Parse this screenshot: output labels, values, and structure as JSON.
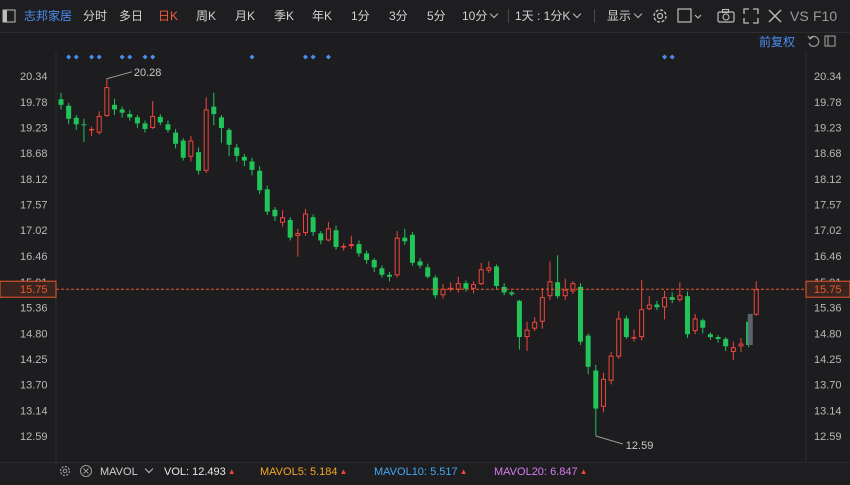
{
  "toolbar": {
    "stock_name": "志邦家居",
    "periods": [
      "分时",
      "多日",
      "日K",
      "周K",
      "月K",
      "季K",
      "年K",
      "1分",
      "3分",
      "5分",
      "10分"
    ],
    "active_period": "日K",
    "multi_period": "1天 : 1分K",
    "display": "显示",
    "vs": "VS",
    "f10": "F10"
  },
  "subbar": {
    "adjust": "前复权"
  },
  "colors": {
    "up": "#f0453c",
    "down": "#22c45a",
    "current": "#e85a2c",
    "accent": "#4c8df0"
  },
  "price_axis": {
    "ticks": [
      "20.34",
      "19.78",
      "19.23",
      "18.68",
      "18.12",
      "17.57",
      "17.02",
      "16.46",
      "15.91",
      "15.36",
      "14.80",
      "14.25",
      "13.70",
      "13.14",
      "12.59"
    ],
    "current_price": "15.75",
    "high_label": "20.28",
    "low_label": "12.59"
  },
  "chart_data": {
    "type": "candlestick",
    "series_note": "daily K-line, forward-adjusted",
    "candles": [
      [
        19.84,
        19.72,
        19.98,
        19.62
      ],
      [
        19.7,
        19.42,
        19.76,
        19.3
      ],
      [
        19.44,
        19.3,
        19.5,
        19.18
      ],
      [
        19.3,
        19.28,
        19.42,
        18.92
      ],
      [
        19.18,
        19.2,
        19.25,
        19.05
      ],
      [
        19.12,
        19.48,
        19.58,
        19.08
      ],
      [
        19.48,
        20.1,
        20.28,
        19.46
      ],
      [
        19.72,
        19.62,
        19.85,
        19.5
      ],
      [
        19.62,
        19.55,
        19.68,
        19.45
      ],
      [
        19.52,
        19.45,
        19.6,
        19.38
      ],
      [
        19.45,
        19.32,
        19.5,
        19.22
      ],
      [
        19.32,
        19.2,
        19.38,
        19.12
      ],
      [
        19.22,
        19.48,
        19.8,
        19.2
      ],
      [
        19.46,
        19.34,
        19.52,
        19.28
      ],
      [
        19.3,
        19.18,
        19.38,
        19.12
      ],
      [
        19.12,
        18.88,
        19.2,
        18.78
      ],
      [
        18.95,
        18.58,
        19.0,
        18.52
      ],
      [
        18.6,
        18.95,
        19.05,
        18.5
      ],
      [
        18.7,
        18.3,
        18.8,
        18.22
      ],
      [
        18.3,
        19.62,
        19.88,
        18.25
      ],
      [
        19.68,
        19.52,
        19.98,
        19.28
      ],
      [
        19.45,
        19.22,
        19.5,
        18.9
      ],
      [
        19.18,
        18.86,
        19.22,
        18.62
      ],
      [
        18.8,
        18.62,
        18.88,
        18.5
      ],
      [
        18.6,
        18.52,
        18.66,
        18.4
      ],
      [
        18.5,
        18.32,
        18.58,
        18.2
      ],
      [
        18.3,
        17.88,
        18.4,
        17.8
      ],
      [
        17.9,
        17.42,
        17.98,
        17.35
      ],
      [
        17.46,
        17.32,
        17.52,
        17.22
      ],
      [
        17.18,
        17.3,
        17.45,
        17.1
      ],
      [
        17.24,
        16.86,
        17.3,
        16.8
      ],
      [
        16.9,
        16.96,
        17.05,
        16.45
      ],
      [
        16.96,
        17.38,
        17.48,
        16.9
      ],
      [
        17.3,
        16.98,
        17.36,
        16.9
      ],
      [
        16.95,
        16.8,
        17.0,
        16.72
      ],
      [
        16.8,
        17.06,
        17.2,
        16.78
      ],
      [
        17.02,
        16.66,
        17.12,
        16.6
      ],
      [
        16.66,
        16.68,
        16.74,
        16.58
      ],
      [
        16.68,
        16.72,
        16.9,
        16.62
      ],
      [
        16.72,
        16.52,
        16.8,
        16.45
      ],
      [
        16.52,
        16.38,
        16.58,
        16.3
      ],
      [
        16.38,
        16.22,
        16.42,
        16.12
      ],
      [
        16.2,
        16.06,
        16.26,
        16.0
      ],
      [
        16.06,
        16.02,
        16.12,
        15.92
      ],
      [
        16.05,
        16.86,
        17.0,
        16.0
      ],
      [
        16.86,
        16.78,
        17.05,
        16.7
      ],
      [
        16.92,
        16.32,
        16.98,
        16.26
      ],
      [
        16.35,
        16.26,
        16.42,
        16.2
      ],
      [
        16.22,
        16.02,
        16.3,
        15.98
      ],
      [
        16.0,
        15.62,
        16.05,
        15.55
      ],
      [
        15.62,
        15.76,
        15.86,
        15.55
      ],
      [
        15.76,
        15.78,
        15.9,
        15.7
      ],
      [
        15.74,
        15.88,
        16.02,
        15.68
      ],
      [
        15.88,
        15.76,
        15.94,
        15.7
      ],
      [
        15.76,
        15.86,
        15.92,
        15.66
      ],
      [
        15.86,
        16.18,
        16.32,
        15.84
      ],
      [
        16.15,
        16.22,
        16.35,
        16.1
      ],
      [
        16.24,
        15.82,
        16.28,
        15.75
      ],
      [
        15.8,
        15.68,
        15.88,
        15.62
      ],
      [
        15.68,
        15.64,
        15.72,
        15.6
      ],
      [
        15.5,
        14.72,
        15.52,
        14.45
      ],
      [
        14.72,
        14.88,
        15.05,
        14.42
      ],
      [
        14.9,
        15.05,
        15.15,
        14.85
      ],
      [
        15.05,
        15.58,
        15.78,
        14.9
      ],
      [
        15.6,
        15.92,
        16.35,
        15.52
      ],
      [
        15.9,
        15.6,
        16.48,
        15.55
      ],
      [
        15.6,
        15.74,
        15.98,
        15.52
      ],
      [
        15.7,
        15.88,
        15.92,
        15.65
      ],
      [
        15.8,
        14.62,
        15.88,
        14.55
      ],
      [
        14.75,
        14.08,
        14.8,
        13.92
      ],
      [
        14.0,
        13.18,
        14.12,
        12.59
      ],
      [
        13.22,
        13.82,
        13.95,
        13.1
      ],
      [
        13.78,
        14.32,
        14.4,
        13.7
      ],
      [
        14.3,
        15.12,
        15.28,
        14.25
      ],
      [
        15.12,
        14.72,
        15.18,
        14.68
      ],
      [
        14.7,
        14.72,
        14.88,
        14.62
      ],
      [
        14.72,
        15.32,
        15.95,
        14.65
      ],
      [
        15.32,
        15.42,
        15.6,
        15.3
      ],
      [
        15.42,
        15.36,
        15.5,
        15.3
      ],
      [
        15.36,
        15.58,
        15.72,
        15.1
      ],
      [
        15.58,
        15.52,
        15.68,
        15.45
      ],
      [
        15.52,
        15.62,
        15.9,
        15.48
      ],
      [
        15.6,
        14.78,
        15.7,
        14.7
      ],
      [
        14.85,
        15.12,
        15.22,
        14.78
      ],
      [
        15.08,
        14.92,
        15.12,
        14.8
      ],
      [
        14.78,
        14.72,
        14.82,
        14.66
      ],
      [
        14.72,
        14.68,
        14.76,
        14.6
      ],
      [
        14.68,
        14.52,
        14.72,
        14.42
      ],
      [
        14.4,
        14.5,
        14.62,
        14.22
      ],
      [
        14.52,
        14.58,
        14.7,
        14.4
      ],
      [
        15.05,
        14.55,
        15.2,
        14.5
      ],
      [
        15.2,
        15.75,
        15.92,
        15.18
      ]
    ],
    "price_range": [
      12.59,
      20.34
    ],
    "event_markers": [
      1,
      2,
      4,
      5,
      8,
      9,
      11,
      12,
      25,
      32,
      33,
      35,
      79,
      80
    ]
  },
  "bottom": {
    "indicator_name": "MAVOL",
    "vol_label": "VOL:",
    "vol_value": "12.493",
    "mavol5_label": "MAVOL5:",
    "mavol5_value": "5.184",
    "mavol10_label": "MAVOL10:",
    "mavol10_value": "5.517",
    "mavol20_label": "MAVOL20:",
    "mavol20_value": "6.847"
  }
}
